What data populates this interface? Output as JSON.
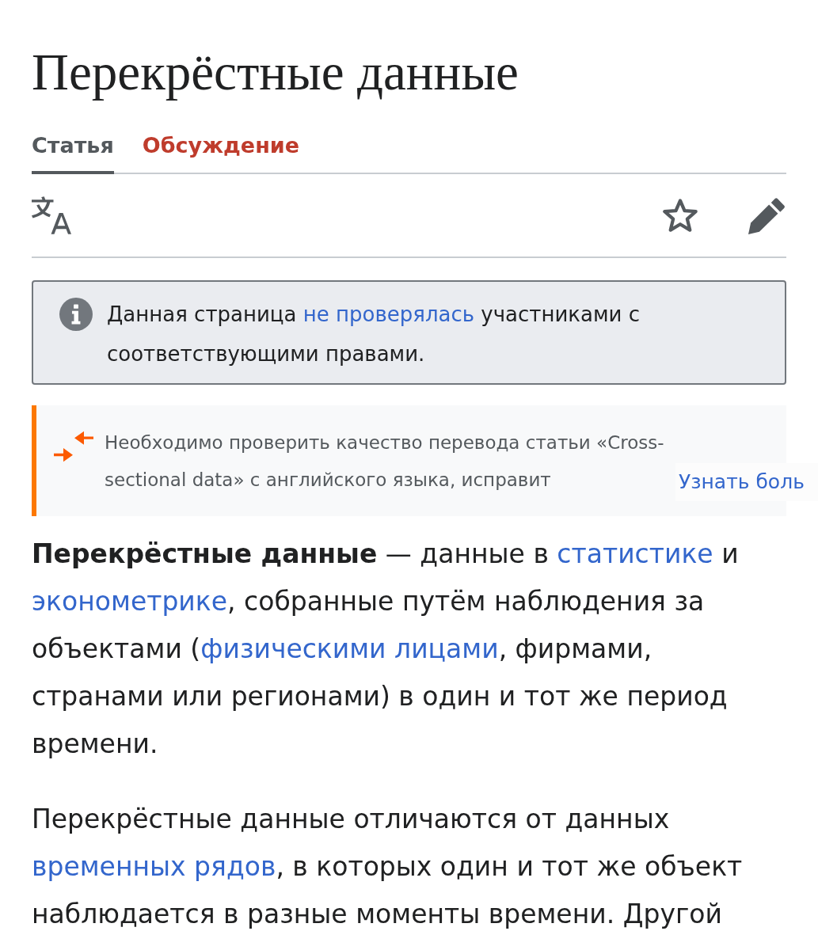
{
  "page": {
    "title": "Перекрёстные данные"
  },
  "tabs": [
    {
      "label": "Статья",
      "selected": true
    },
    {
      "label": "Обсуждение",
      "selected": false
    }
  ],
  "notice": {
    "segments": [
      {
        "kind": "plain",
        "text": "Данная страница "
      },
      {
        "kind": "link",
        "text": "не проверялась"
      },
      {
        "kind": "plain",
        "text": " участниками с соответствующими правами."
      }
    ]
  },
  "translation_banner": {
    "text": "Необходимо проверить качество перевода статьи «Cross-sectional data» с английского языка, исправит",
    "link": "Узнать боль"
  },
  "paragraphs": [
    {
      "segments": [
        {
          "kind": "bold",
          "text": "Перекрёстные данные"
        },
        {
          "kind": "plain",
          "text": " — данные в "
        },
        {
          "kind": "link",
          "text": "статистике"
        },
        {
          "kind": "plain",
          "text": " и "
        },
        {
          "kind": "link",
          "text": "эконометрике"
        },
        {
          "kind": "plain",
          "text": ", собранные путём наблюдения за объектами ("
        },
        {
          "kind": "link",
          "text": "физическими лицами"
        },
        {
          "kind": "plain",
          "text": ", фирмами, странами или регионами) в один и тот же период времени."
        }
      ]
    },
    {
      "segments": [
        {
          "kind": "plain",
          "text": "Перекрёстные данные отличаются от данных "
        },
        {
          "kind": "link",
          "text": "временных рядов"
        },
        {
          "kind": "plain",
          "text": ", в которых один и тот же объект наблюдается в разные моменты времени. Другой"
        }
      ]
    }
  ]
}
